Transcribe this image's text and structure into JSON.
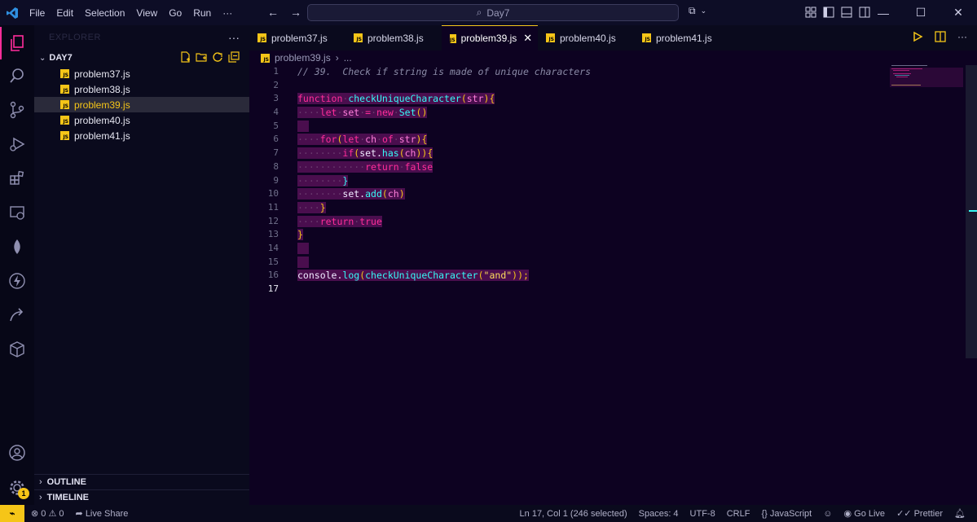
{
  "menu": [
    "File",
    "Edit",
    "Selection",
    "View",
    "Go",
    "Run",
    "···"
  ],
  "search": {
    "text": "Day7"
  },
  "sidebar": {
    "title": "EXPLORER",
    "more": "···",
    "folder": "DAY7",
    "files": [
      "problem37.js",
      "problem38.js",
      "problem39.js",
      "problem40.js",
      "problem41.js"
    ],
    "selected_index": 2,
    "outline": "OUTLINE",
    "timeline": "TIMELINE"
  },
  "activity_badge": "1",
  "tabs": [
    {
      "label": "problem37.js"
    },
    {
      "label": "problem38.js"
    },
    {
      "label": "problem39.js",
      "active": true
    },
    {
      "label": "problem40.js"
    },
    {
      "label": "problem41.js"
    }
  ],
  "breadcrumb": {
    "file": "problem39.js",
    "sep": "›",
    "rest": "..."
  },
  "editor": {
    "current_line": 17,
    "lines": [
      [
        {
          "t": "// 39.  Check if string is made of unique characters",
          "c": "comment"
        }
      ],
      [],
      [
        {
          "t": "function",
          "c": "kw"
        },
        {
          "t": "·",
          "c": "ws"
        },
        {
          "t": "checkUniqueCharacter",
          "c": "fn"
        },
        {
          "t": "(",
          "c": "punc"
        },
        {
          "t": "str",
          "c": "var"
        },
        {
          "t": "){",
          "c": "punc"
        }
      ],
      [
        {
          "t": "····",
          "c": "ws"
        },
        {
          "t": "let",
          "c": "kw"
        },
        {
          "t": "·",
          "c": "ws"
        },
        {
          "t": "set",
          "c": "var"
        },
        {
          "t": "·",
          "c": "ws"
        },
        {
          "t": "=",
          "c": "kw"
        },
        {
          "t": "·",
          "c": "ws"
        },
        {
          "t": "new",
          "c": "kw"
        },
        {
          "t": "·",
          "c": "ws"
        },
        {
          "t": "Set",
          "c": "fn"
        },
        {
          "t": "()",
          "c": "punc"
        }
      ],
      [],
      [
        {
          "t": "····",
          "c": "ws"
        },
        {
          "t": "for",
          "c": "kw"
        },
        {
          "t": "(",
          "c": "punc"
        },
        {
          "t": "let",
          "c": "kw"
        },
        {
          "t": "·",
          "c": "ws"
        },
        {
          "t": "ch",
          "c": "var"
        },
        {
          "t": "·",
          "c": "ws"
        },
        {
          "t": "of",
          "c": "kw"
        },
        {
          "t": "·",
          "c": "ws"
        },
        {
          "t": "str",
          "c": "var"
        },
        {
          "t": "){",
          "c": "punc"
        }
      ],
      [
        {
          "t": "········",
          "c": "ws"
        },
        {
          "t": "if",
          "c": "kw"
        },
        {
          "t": "(",
          "c": "punc"
        },
        {
          "t": "set",
          "c": "plain"
        },
        {
          "t": ".",
          "c": "plain"
        },
        {
          "t": "has",
          "c": "fn"
        },
        {
          "t": "(",
          "c": "punc"
        },
        {
          "t": "ch",
          "c": "var"
        },
        {
          "t": ")){",
          "c": "punc"
        }
      ],
      [
        {
          "t": "············",
          "c": "ws"
        },
        {
          "t": "return",
          "c": "kw"
        },
        {
          "t": "·",
          "c": "ws"
        },
        {
          "t": "false",
          "c": "kw"
        }
      ],
      [
        {
          "t": "········",
          "c": "ws"
        },
        {
          "t": "}",
          "c": "fn"
        }
      ],
      [
        {
          "t": "········",
          "c": "ws"
        },
        {
          "t": "set",
          "c": "plain"
        },
        {
          "t": ".",
          "c": "plain"
        },
        {
          "t": "add",
          "c": "fn"
        },
        {
          "t": "(",
          "c": "punc"
        },
        {
          "t": "ch",
          "c": "var"
        },
        {
          "t": ")",
          "c": "punc"
        }
      ],
      [
        {
          "t": "····",
          "c": "ws"
        },
        {
          "t": "}",
          "c": "punc"
        }
      ],
      [
        {
          "t": "····",
          "c": "ws"
        },
        {
          "t": "return",
          "c": "kw"
        },
        {
          "t": "·",
          "c": "ws"
        },
        {
          "t": "true",
          "c": "kw"
        }
      ],
      [
        {
          "t": "}",
          "c": "punc"
        }
      ],
      [],
      [],
      [
        {
          "t": "console",
          "c": "plain"
        },
        {
          "t": ".",
          "c": "plain"
        },
        {
          "t": "log",
          "c": "fn"
        },
        {
          "t": "(",
          "c": "punc"
        },
        {
          "t": "checkUniqueCharacter",
          "c": "fn"
        },
        {
          "t": "(",
          "c": "punc"
        },
        {
          "t": "\"and\"",
          "c": "str"
        },
        {
          "t": "));",
          "c": "punc"
        }
      ],
      []
    ],
    "highlight_lines": [
      3,
      4,
      5,
      6,
      7,
      8,
      9,
      10,
      11,
      12,
      13,
      14,
      15,
      16
    ]
  },
  "status": {
    "errors": "0",
    "warnings": "0",
    "live_share": "Live Share",
    "position": "Ln 17, Col 1 (246 selected)",
    "spaces": "Spaces: 4",
    "encoding": "UTF-8",
    "eol": "CRLF",
    "language": "JavaScript",
    "go_live": "Go Live",
    "prettier": "Prettier"
  },
  "colors": {
    "accent_yellow": "#f5c518",
    "accent_pink": "#ff2d9a",
    "accent_cyan": "#36f9f6",
    "editor_bg": "#0d0221"
  }
}
